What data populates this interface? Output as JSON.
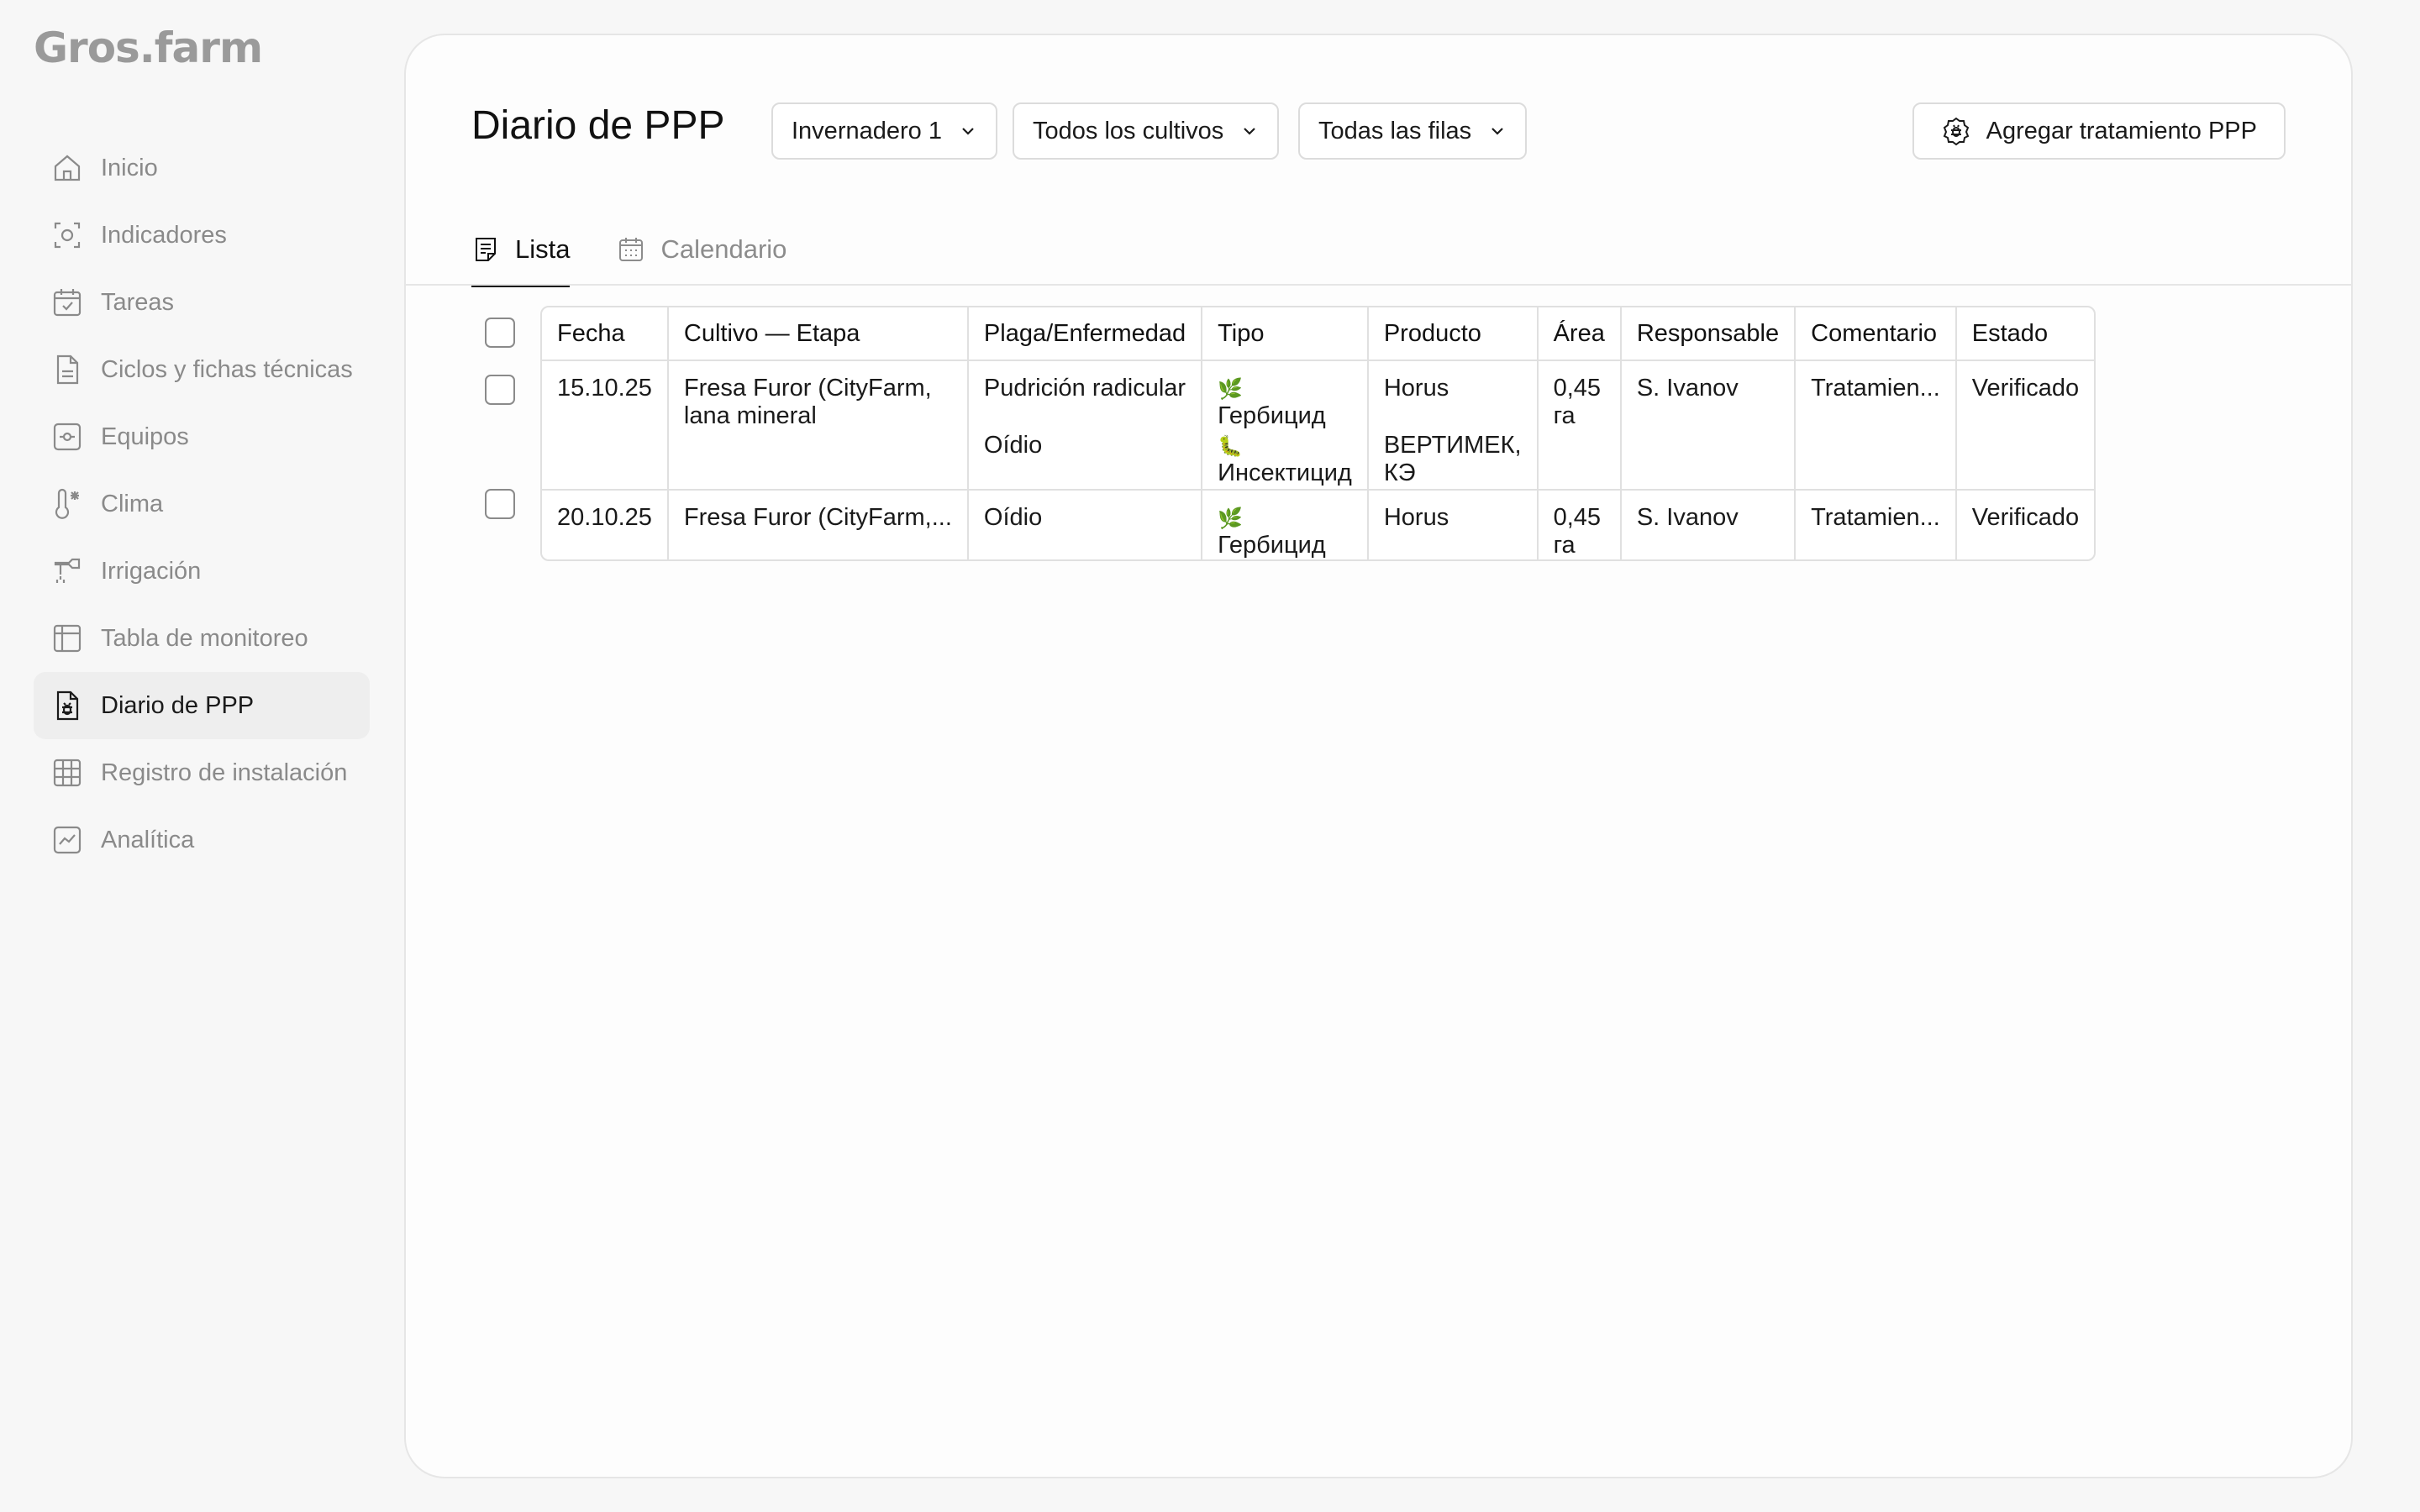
{
  "app": {
    "logo": "Gros.farm"
  },
  "sidebar": {
    "items": [
      {
        "label": "Inicio",
        "icon": "home-icon"
      },
      {
        "label": "Indicadores",
        "icon": "sensor-icon"
      },
      {
        "label": "Tareas",
        "icon": "calendar-check-icon"
      },
      {
        "label": "Ciclos y fichas técnicas",
        "icon": "document-icon"
      },
      {
        "label": "Equipos",
        "icon": "device-icon"
      },
      {
        "label": "Clima",
        "icon": "thermometer-icon"
      },
      {
        "label": "Irrigación",
        "icon": "irrigation-icon"
      },
      {
        "label": "Tabla de monitoreo",
        "icon": "table-icon"
      },
      {
        "label": "Diario de PPP",
        "icon": "bug-document-icon",
        "active": true
      },
      {
        "label": "Registro de instalación",
        "icon": "grid-icon"
      },
      {
        "label": "Analítica",
        "icon": "chart-icon"
      }
    ]
  },
  "header": {
    "title": "Diario de PPP",
    "filters": {
      "greenhouse": "Invernadero 1",
      "crops": "Todos los cultivos",
      "rows": "Todas las filas"
    },
    "add_button": "Agregar tratamiento PPP"
  },
  "tabs": [
    {
      "label": "Lista",
      "active": true
    },
    {
      "label": "Calendario",
      "active": false
    }
  ],
  "table": {
    "columns": [
      "Fecha",
      "Cultivo — Etapa",
      "Plaga/Enfermedad",
      "Tipo",
      "Producto",
      "Área",
      "Responsable",
      "Comentario",
      "Estado"
    ],
    "rows": [
      {
        "fecha": "15.10.25",
        "cultivo": "Fresa Furor (CityFarm, lana mineral",
        "plaga": [
          "Pudrición radicular",
          "Oídio"
        ],
        "tipo": [
          {
            "emoji": "🌿",
            "label": "Гербицид"
          },
          {
            "emoji": "🐛",
            "label": "Инсектицид"
          }
        ],
        "producto": [
          "Horus",
          "ВЕРТИМЕК, КЭ"
        ],
        "area": "0,45 га",
        "responsable": "S. Ivanov",
        "comentario": "Tratamien...",
        "estado": "Verificado"
      },
      {
        "fecha": "20.10.25",
        "cultivo": "Fresa Furor (CityFarm,...",
        "plaga": [
          "Oídio"
        ],
        "tipo": [
          {
            "emoji": "🌿",
            "label": "Гербицид"
          }
        ],
        "producto": [
          "Horus"
        ],
        "area": "0,45 га",
        "responsable": "S. Ivanov",
        "comentario": "Tratamien...",
        "estado": "Verificado"
      }
    ]
  },
  "colors": {
    "background": "#f7f7f7",
    "panel": "#fdfdfd",
    "border": "#e0e0e0",
    "muted_text": "#8a8a8a"
  }
}
